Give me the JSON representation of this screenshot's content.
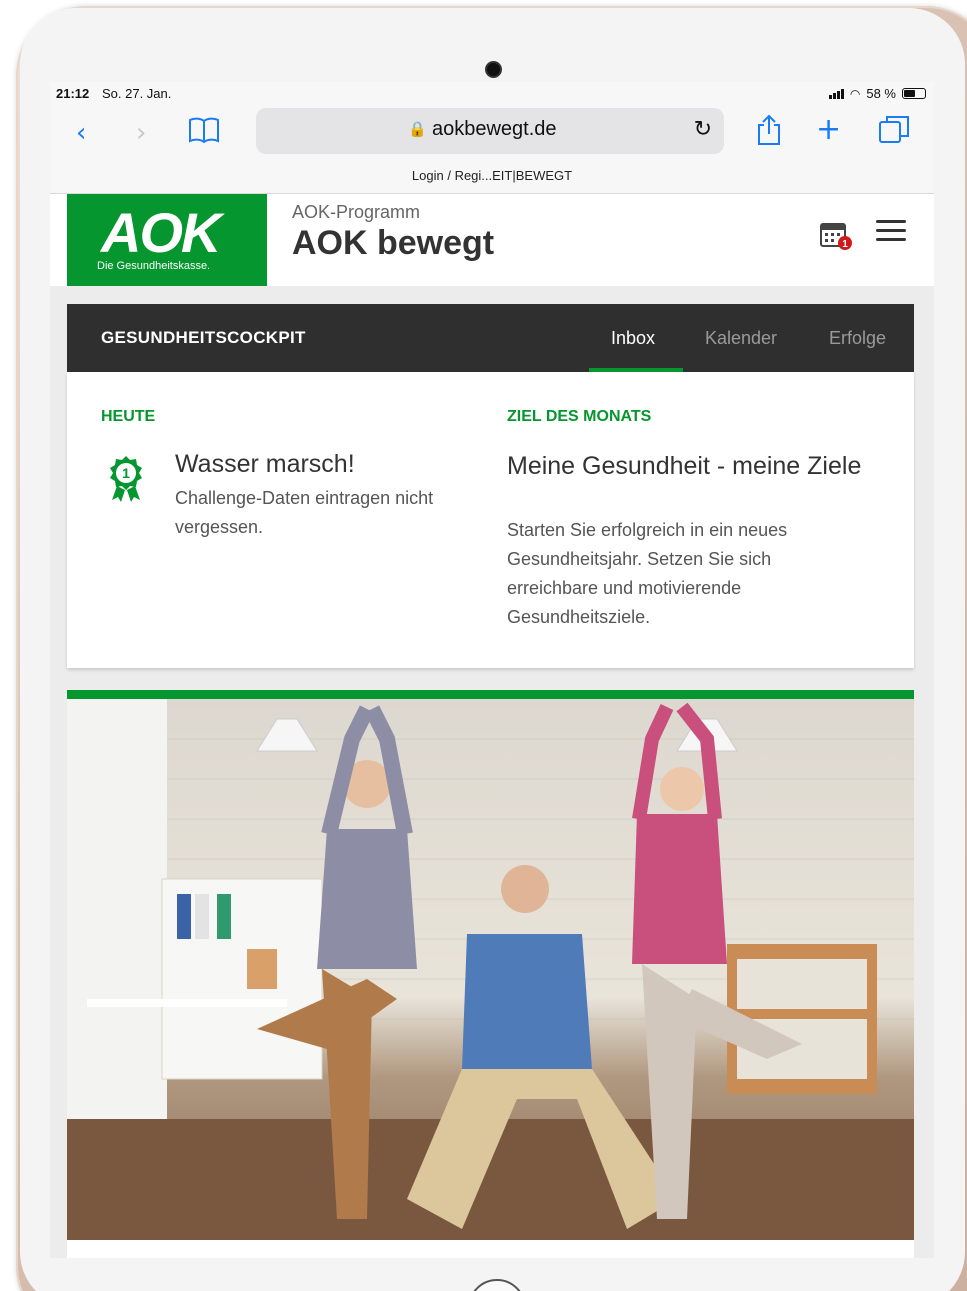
{
  "status_bar": {
    "time": "21:12",
    "date": "So. 27. Jan.",
    "battery": "58 %"
  },
  "browser": {
    "url": "aokbewegt.de",
    "tab_title": "Login / Regi...EIT|BEWEGT"
  },
  "header": {
    "logo_text": "AOK",
    "logo_subtitle": "Die Gesundheitskasse.",
    "program_label": "AOK-Programm",
    "program_title": "AOK bewegt",
    "calendar_badge": "1"
  },
  "cockpit": {
    "title": "GESUNDHEITSCOCKPIT",
    "tabs": [
      {
        "label": "Inbox",
        "active": true
      },
      {
        "label": "Kalender",
        "active": false
      },
      {
        "label": "Erfolge",
        "active": false
      }
    ],
    "today": {
      "label": "HEUTE",
      "badge_number": "1",
      "title": "Wasser marsch!",
      "description": "Challenge-Daten eintragen nicht vergessen."
    },
    "goal": {
      "label": "ZIEL DES MONATS",
      "title": "Meine Gesundheit - meine Ziele",
      "description": "Starten Sie erfolgreich in ein neues Gesundheitsjahr. Setzen Sie sich erreichbare und motivierende Gesundheitsziele."
    }
  },
  "colors": {
    "brand_green": "#06962f",
    "cockpit_bar": "#2f2f2f",
    "link_blue": "#1a7cf5"
  }
}
